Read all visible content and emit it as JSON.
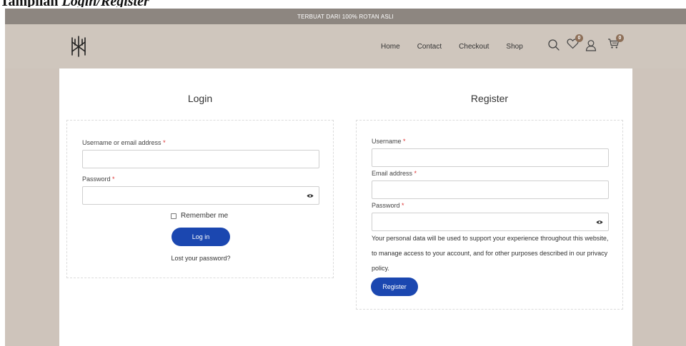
{
  "document": {
    "caption_plain": "Tampilan ",
    "caption_italic": "Login/Register"
  },
  "topbar": {
    "text": "TERBUAT DARI 100% ROTAN ASLI"
  },
  "nav": {
    "items": [
      "Home",
      "Contact",
      "Checkout",
      "Shop"
    ]
  },
  "header_icons": {
    "wishlist_count": "0",
    "cart_count": "0"
  },
  "login": {
    "title": "Login",
    "username_label": "Username or email address",
    "password_label": "Password",
    "required_mark": "*",
    "remember_label": "Remember me",
    "login_button": "Log in",
    "lost_password": "Lost your password?"
  },
  "register": {
    "title": "Register",
    "username_label": "Username",
    "email_label": "Email address",
    "password_label": "Password",
    "required_mark": "*",
    "privacy_text": "Your personal data will be used to support your experience throughout this website, to manage access to your account, and for other purposes described in our privacy policy.",
    "register_button": "Register"
  },
  "colors": {
    "accent": "#1b47b0",
    "topbar": "#8d8680",
    "header": "#cfc6bd",
    "background": "#cec4bb"
  }
}
